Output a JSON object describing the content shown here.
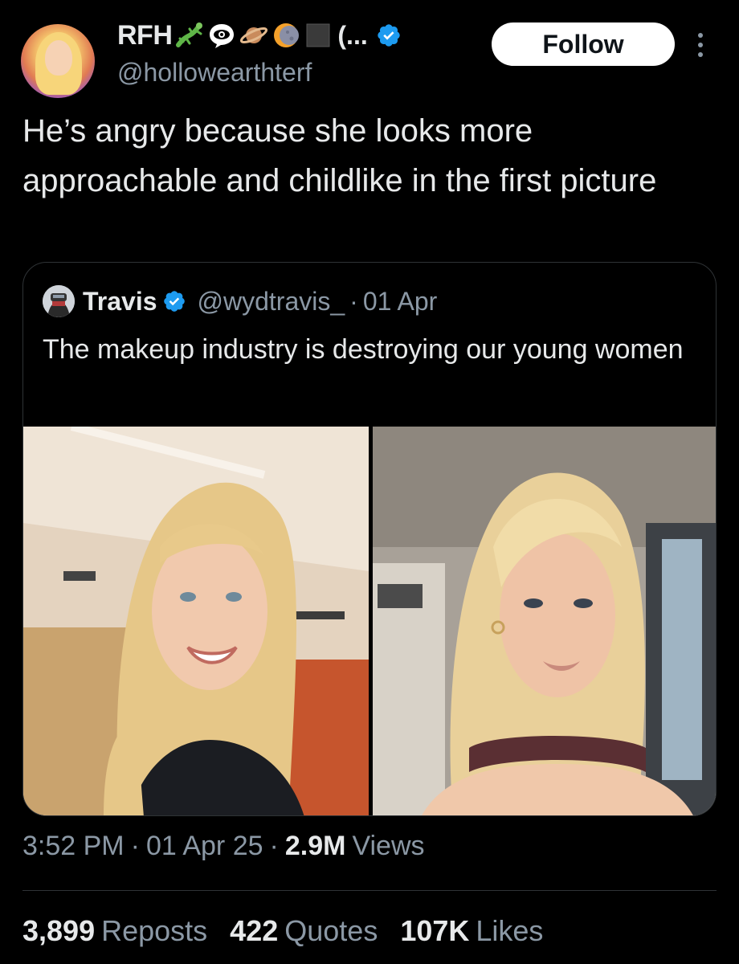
{
  "author": {
    "display_name": "RFH",
    "name_trailing": "(...",
    "handle": "@hollowearthterf",
    "emojis": [
      "lizard-emoji",
      "eye-in-speech-bubble-emoji",
      "ringed-planet-emoji",
      "moon-emoji",
      "black-square-emoji"
    ],
    "verified": true
  },
  "follow_label": "Follow",
  "tweet": {
    "text": "He’s angry because she looks more approachable and childlike in the first picture"
  },
  "quoted": {
    "name": "Travis",
    "handle": "@wydtravis_",
    "separator": "·",
    "date": "01 Apr",
    "text": "The makeup industry is destroying our young women",
    "verified": true
  },
  "meta": {
    "time": "3:52 PM",
    "sep1": "·",
    "date": "01 Apr 25",
    "sep2": "·",
    "views_count": "2.9M",
    "views_label": "Views"
  },
  "stats": {
    "reposts_count": "3,899",
    "reposts_label": "Reposts",
    "quotes_count": "422",
    "quotes_label": "Quotes",
    "likes_count": "107K",
    "likes_label": "Likes"
  },
  "colors": {
    "background": "#000000",
    "text_primary": "#e7e9ea",
    "text_secondary": "#8b98a5",
    "verified_blue": "#1d9bf0",
    "border": "#2f3336"
  }
}
